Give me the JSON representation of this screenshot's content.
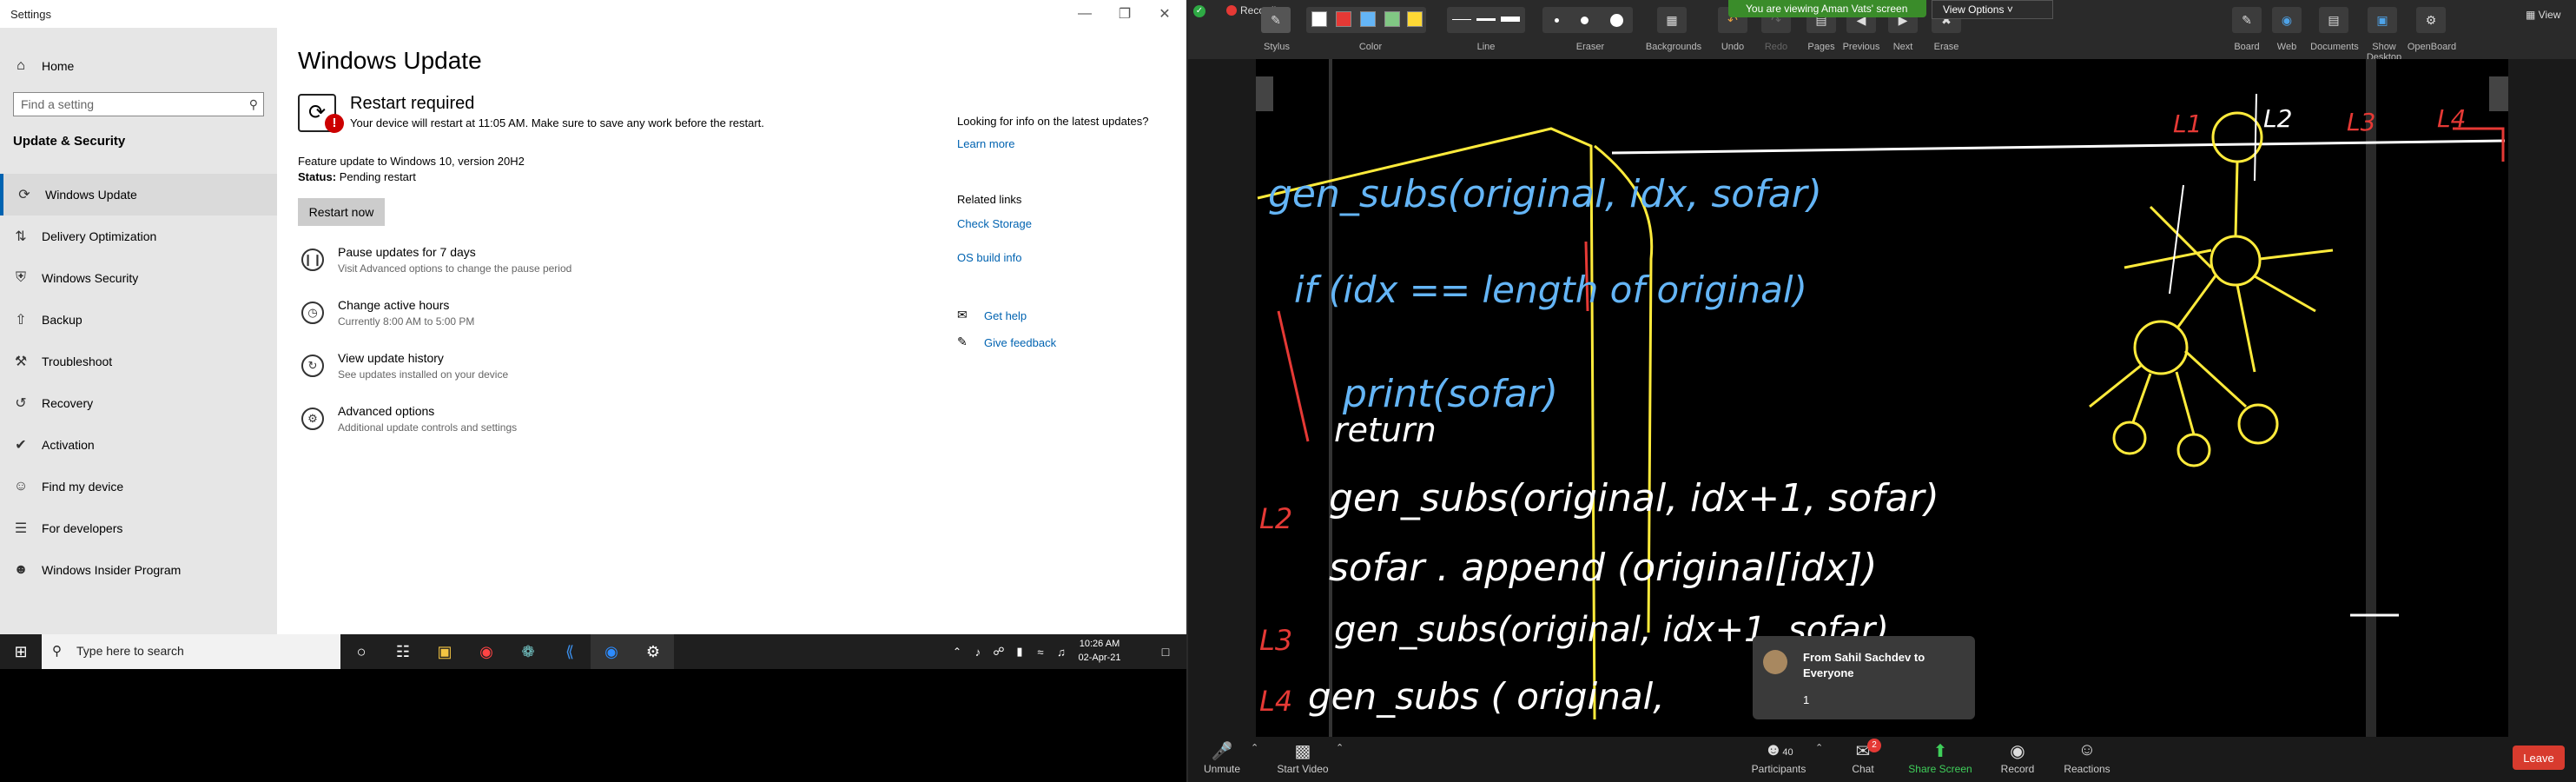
{
  "settings": {
    "window_title": "Settings",
    "sidebar": {
      "home": "Home",
      "search_placeholder": "Find a setting",
      "section_heading": "Update & Security",
      "items": [
        {
          "label": "Windows Update",
          "icon": "refresh-icon"
        },
        {
          "label": "Delivery Optimization",
          "icon": "delivery-icon"
        },
        {
          "label": "Windows Security",
          "icon": "shield-icon"
        },
        {
          "label": "Backup",
          "icon": "backup-icon"
        },
        {
          "label": "Troubleshoot",
          "icon": "wrench-icon"
        },
        {
          "label": "Recovery",
          "icon": "recovery-icon"
        },
        {
          "label": "Activation",
          "icon": "check-circle-icon"
        },
        {
          "label": "Find my device",
          "icon": "person-icon"
        },
        {
          "label": "For developers",
          "icon": "sliders-icon"
        },
        {
          "label": "Windows Insider Program",
          "icon": "insider-icon"
        }
      ]
    },
    "main": {
      "title": "Windows Update",
      "restart_heading": "Restart required",
      "restart_text": "Your device will restart at 11:05 AM. Make sure to save any work before the restart.",
      "feature_update": "Feature update to Windows 10, version 20H2",
      "status_label": "Status:",
      "status_value": "Pending restart",
      "restart_button": "Restart now",
      "options": [
        {
          "title": "Pause updates for 7 days",
          "sub": "Visit Advanced options to change the pause period"
        },
        {
          "title": "Change active hours",
          "sub": "Currently 8:00 AM to 5:00 PM"
        },
        {
          "title": "View update history",
          "sub": "See updates installed on your device"
        },
        {
          "title": "Advanced options",
          "sub": "Additional update controls and settings"
        }
      ],
      "right_info_title": "Looking for info on the latest updates?",
      "learn_more": "Learn more",
      "related_links": "Related links",
      "check_storage": "Check Storage",
      "os_build_info": "OS build info",
      "get_help": "Get help",
      "give_feedback": "Give feedback"
    }
  },
  "taskbar": {
    "search_placeholder": "Type here to search",
    "time": "10:26 AM",
    "date": "02-Apr-21"
  },
  "zoom": {
    "recording": "Recording",
    "sharing_banner": "You are viewing Aman Vats' screen",
    "view_options": "View Options",
    "view_right": "View",
    "tools": [
      "Stylus",
      "Color",
      "Line",
      "Eraser",
      "Backgrounds",
      "Undo",
      "Redo",
      "Pages",
      "Previous",
      "Next",
      "Erase"
    ],
    "right_tools": [
      "Board",
      "Web",
      "Documents",
      "Show Desktop",
      "OpenBoard"
    ],
    "swatch_colors": [
      "#ffffff",
      "#e53935",
      "#64b5f6",
      "#81c784",
      "#fdd835"
    ],
    "board_labels": {
      "l1": "L1",
      "l2": "L2",
      "l3": "L3",
      "l4": "L4",
      "line1": "gen_subs(original, idx, sofar)",
      "line2": "if (idx == length of original)",
      "line3": "print(sofar)",
      "line4": "return",
      "line5": "gen_subs(original, idx+1, sofar)",
      "line6": "sofar . append (original[idx])",
      "line7": "gen_subs(original, idx+1, sofar)",
      "line8": "gen_subs ( original,"
    },
    "chat_popup": {
      "from": "From Sahil Sachdev to Everyone",
      "message": "1"
    },
    "bottom": {
      "unmute": "Unmute",
      "start_video": "Start Video",
      "participants": "Participants",
      "participants_count": "40",
      "chat": "Chat",
      "chat_badge": "2",
      "share_screen": "Share Screen",
      "record": "Record",
      "reactions": "Reactions",
      "leave": "Leave"
    }
  }
}
